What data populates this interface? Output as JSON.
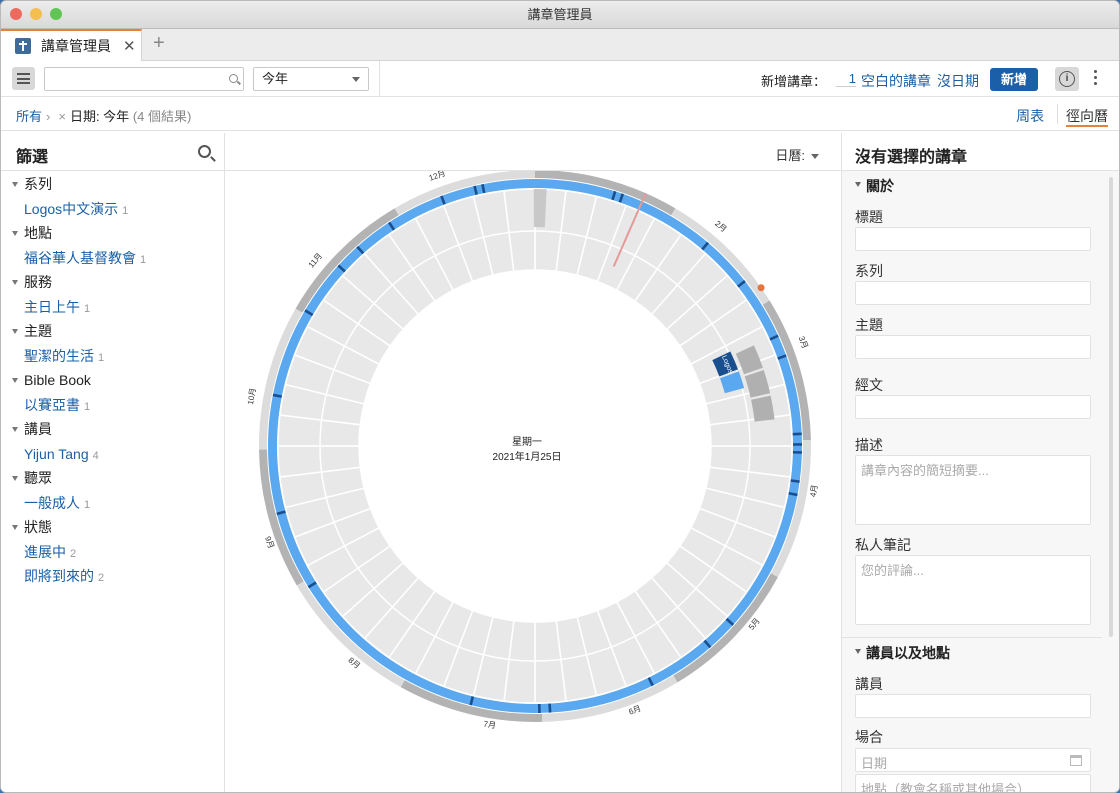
{
  "window": {
    "title": "講章管理員"
  },
  "tab": {
    "label": "講章管理員",
    "close": "✕",
    "add": "+"
  },
  "toolbar": {
    "search_placeholder": "",
    "date_filter": "今年",
    "new_label": "新增講章：",
    "new_count": "1",
    "blank_link": "空白的講章",
    "no_date_link": "沒日期",
    "add_button": "新增"
  },
  "breadcrumb": {
    "all": "所有",
    "sep": "›",
    "remove": "×",
    "filter": "日期: 今年",
    "count": "(4 個結果)"
  },
  "views": {
    "weekly": "周表",
    "radial": "徑向曆"
  },
  "filters": {
    "title": "篩選",
    "groups": [
      {
        "label": "系列",
        "value": "Logos中文演示",
        "count": "1"
      },
      {
        "label": "地點",
        "value": "福谷華人基督教會",
        "count": "1"
      },
      {
        "label": "服務",
        "value": "主日上午",
        "count": "1"
      },
      {
        "label": "主題",
        "value": "聖潔的生活",
        "count": "1"
      },
      {
        "label": "Bible Book",
        "value": "以賽亞書",
        "count": "1"
      },
      {
        "label": "講員",
        "value": "Yijun Tang",
        "count": "4"
      },
      {
        "label": "聽眾",
        "value": "一般成人",
        "count": "1"
      },
      {
        "label": "狀態",
        "value": "進展中",
        "count": "2",
        "value2": "即將到來的",
        "count2": "2"
      }
    ]
  },
  "calendar": {
    "selector": "日曆:",
    "center_day": "星期一",
    "center_date": "2021年1月25日",
    "months": [
      "1月 2021",
      "2月",
      "3月",
      "4月",
      "5月",
      "6月",
      "7月",
      "8月",
      "9月",
      "10月",
      "11月",
      "12月"
    ],
    "event_label": "Logos"
  },
  "details": {
    "title": "沒有選擇的講章",
    "section_about": "關於",
    "title_label": "標題",
    "series_label": "系列",
    "topic_label": "主題",
    "scripture_label": "經文",
    "desc_label": "描述",
    "desc_placeholder": "講章內容的簡短摘要...",
    "notes_label": "私人筆記",
    "notes_placeholder": "您的評論...",
    "section_speaker": "講員以及地點",
    "speaker_label": "講員",
    "occasion_label": "場合",
    "date_placeholder": "日期",
    "place_placeholder": "地點（教會名稱或其他場合）"
  }
}
